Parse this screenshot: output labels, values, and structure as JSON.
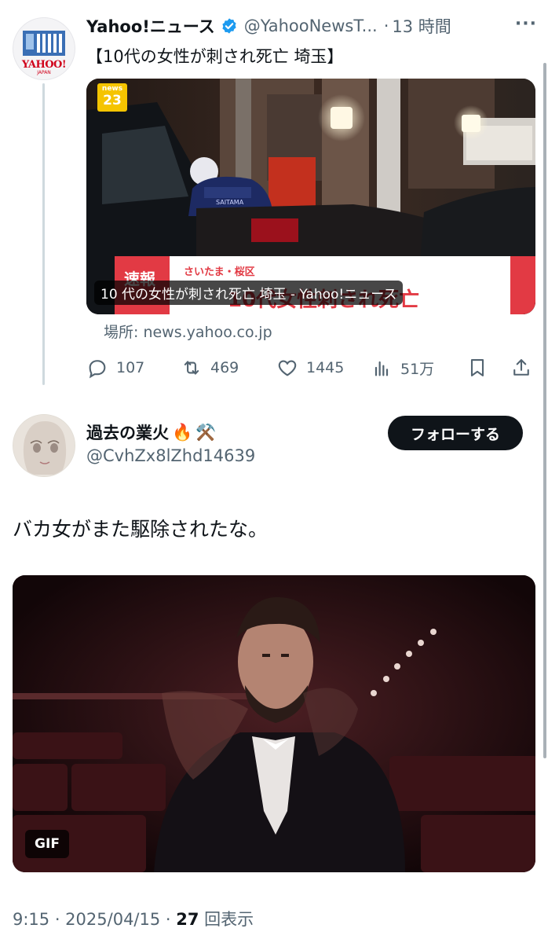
{
  "quoted_tweet": {
    "account_name": "Yahoo!ニュース",
    "handle": "@YahooNewsT...",
    "time_sep": "·",
    "time": "13 時間",
    "more_label": "···",
    "avatar_logo_text": "YAHOO!",
    "avatar_logo_sub": "JAPAN",
    "headline": "【10代の女性が刺され死亡 埼玉】",
    "card": {
      "caption": "10 代の女性が刺され死亡 埼玉 - Yahoo!ニュース",
      "badge_top": "news",
      "badge_num": "23",
      "lower_third_label": "速報",
      "lower_third_location": "さいたま・桜区",
      "lower_third_title": "10代女性刺され死亡",
      "vest_text": "SAITAMA"
    },
    "source_label": "場所: news.yahoo.co.jp",
    "stats": {
      "replies": "107",
      "reposts": "469",
      "likes": "1445",
      "views": "51万"
    }
  },
  "reply": {
    "display_name": "過去の業火",
    "emoji_fire": "🔥",
    "emoji_tools": "⚒️",
    "handle": "@CvhZx8lZhd14639",
    "follow_label": "フォローする",
    "text": "バカ女がまた駆除されたな。",
    "media_badge": "GIF",
    "timestamp": "9:15 · 2025/04/15 · ",
    "view_count": "27",
    "view_label": " 回表示"
  },
  "colors": {
    "text_primary": "#0f1419",
    "text_secondary": "#536471",
    "verified_blue": "#1d9bf0",
    "follow_bg": "#0f1419"
  }
}
